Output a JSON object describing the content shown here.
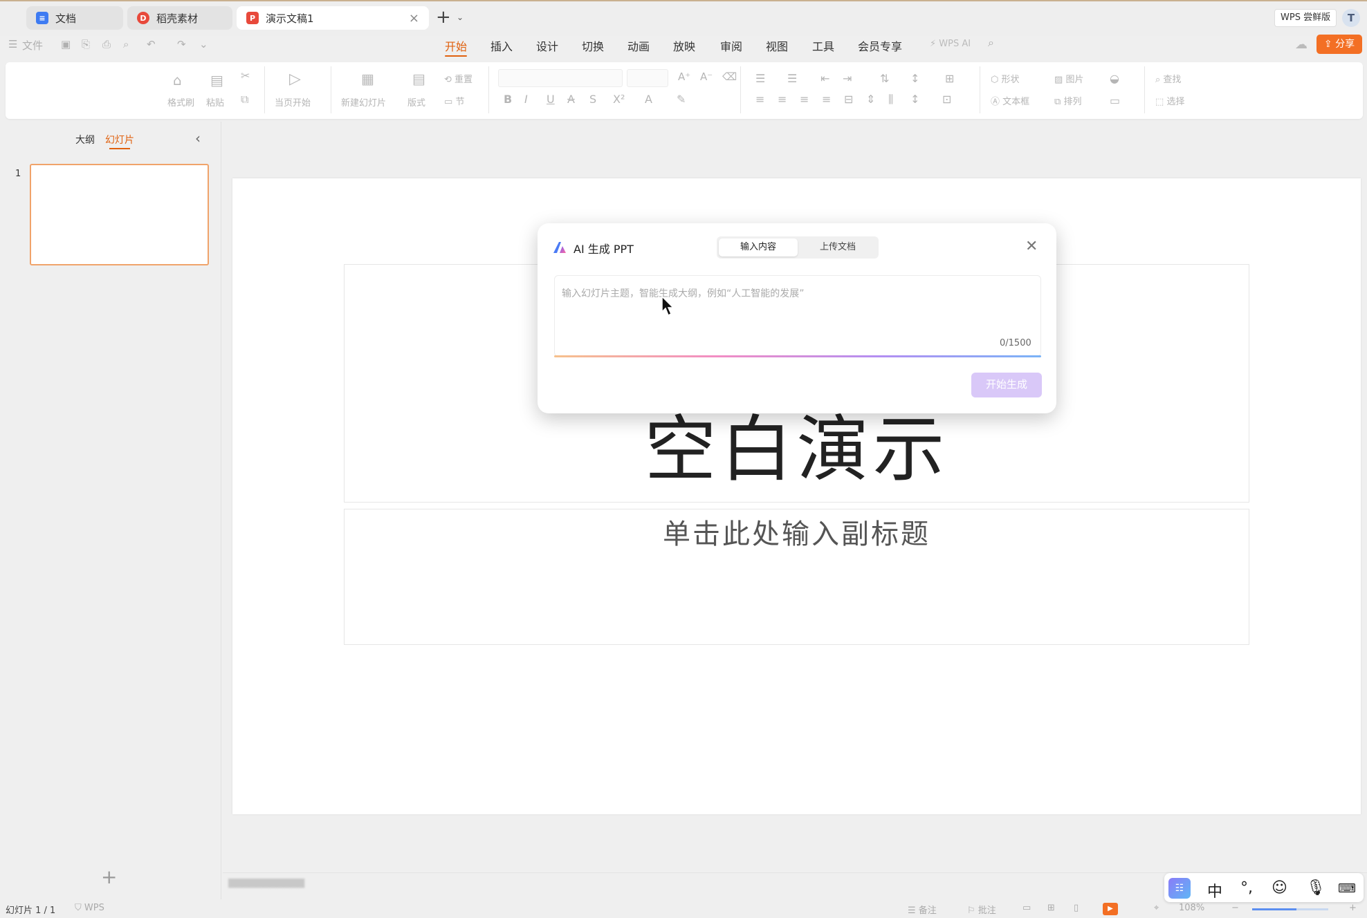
{
  "tabs": [
    {
      "label": "文档",
      "icon": "doc-icon",
      "active": false
    },
    {
      "label": "稻壳素材",
      "icon": "docer-icon",
      "active": false
    },
    {
      "label": "演示文稿1",
      "icon": "ppt-icon",
      "active": true
    }
  ],
  "tabbar": {
    "new_tab": "+",
    "edition": "WPS 尝鲜版",
    "avatar": "T"
  },
  "quick": {
    "file": "文件"
  },
  "menus": [
    "开始",
    "插入",
    "设计",
    "切换",
    "动画",
    "放映",
    "审阅",
    "视图",
    "工具",
    "会员专享"
  ],
  "active_menu": "开始",
  "wps_ai": "WPS AI",
  "share": "分享",
  "ribbon": {
    "format_painter": "格式刷",
    "paste": "粘贴",
    "from_current": "当页开始",
    "new_slide": "新建幻灯片",
    "layout": "版式",
    "reset": "重置",
    "section": "节",
    "shape": "形状",
    "picture": "图片",
    "textbox": "文本框",
    "arrange": "排列",
    "find": "查找",
    "select": "选择"
  },
  "panel": {
    "outline": "大纲",
    "slides": "幻灯片",
    "slide_number": "1"
  },
  "slide": {
    "title": "空白演示",
    "subtitle": "单击此处输入副标题"
  },
  "dialog": {
    "title": "AI 生成 PPT",
    "tab_input": "输入内容",
    "tab_upload": "上传文档",
    "placeholder": "输入幻灯片主题，智能生成大纲，例如“人工智能的发展”",
    "counter": "0/1500",
    "generate": "开始生成"
  },
  "status": {
    "slide_pos": "幻灯片 1 / 1",
    "wps": "WPS",
    "notes": "备注",
    "comment": "批注",
    "zoom": "108%"
  },
  "ime": {
    "lang": "中",
    "punct": "°,"
  },
  "colors": {
    "accent": "#e0610f",
    "share": "#f36f24",
    "generate_disabled": "#d9c8f8"
  }
}
